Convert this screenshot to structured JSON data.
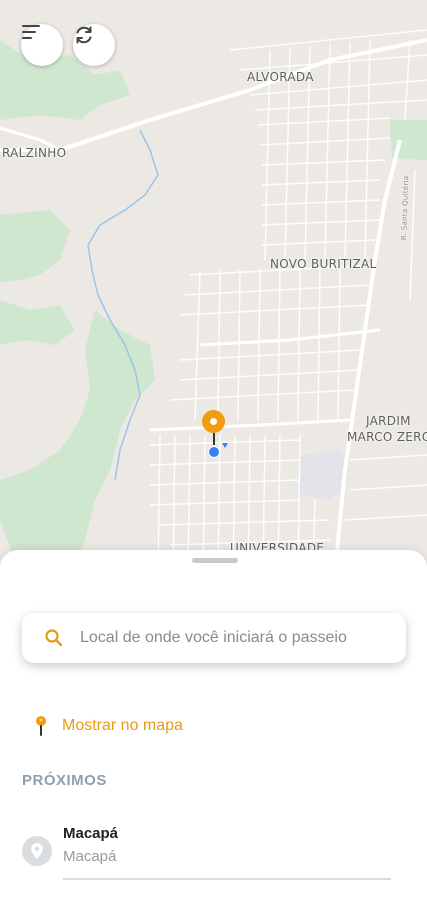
{
  "map": {
    "labels": {
      "alvorada": "ALVORADA",
      "ralzinho": "RALZINHO",
      "novo_buritizal": "NOVO BURITIZAL",
      "jardim": "JARDIM",
      "marco_zero": "MARCO ZERO",
      "universidade": "UNIVERSIDADE",
      "street_small": "R. Santa Quitéria"
    },
    "menu_icon": "menu-lines-icon",
    "refresh_icon": "refresh-icon"
  },
  "colors": {
    "accent": "#f29d0f",
    "location": "#3d7ef5",
    "section_title": "#8fa0ad"
  },
  "search": {
    "placeholder": "Local de onde você iniciará o passeio",
    "icon": "search-icon"
  },
  "show_map": {
    "label": "Mostrar no mapa",
    "icon": "pin-icon"
  },
  "nearby": {
    "title": "PRÓXIMOS",
    "items": [
      {
        "name": "Macapá",
        "subtitle": "Macapá",
        "icon": "location-icon"
      }
    ]
  }
}
